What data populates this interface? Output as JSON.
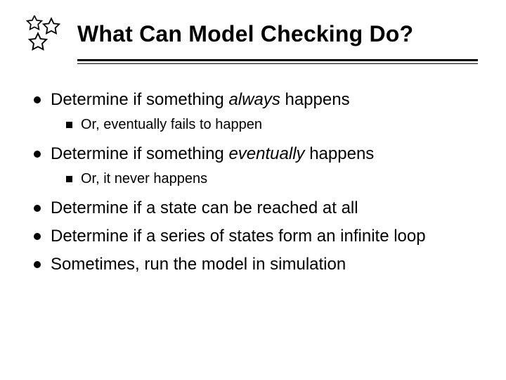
{
  "title": "What Can Model Checking Do?",
  "b1a": "Determine if something ",
  "b1b": "always",
  "b1c": " happens",
  "b1_1": "Or, eventually fails to happen",
  "b2a": "Determine if something ",
  "b2b": "eventually",
  "b2c": " happens",
  "b2_1": "Or, it never happens",
  "b3": "Determine if a state can be reached at all",
  "b4": "Determine if a series of states form an infinite loop",
  "b5": "Sometimes, run the model in simulation"
}
